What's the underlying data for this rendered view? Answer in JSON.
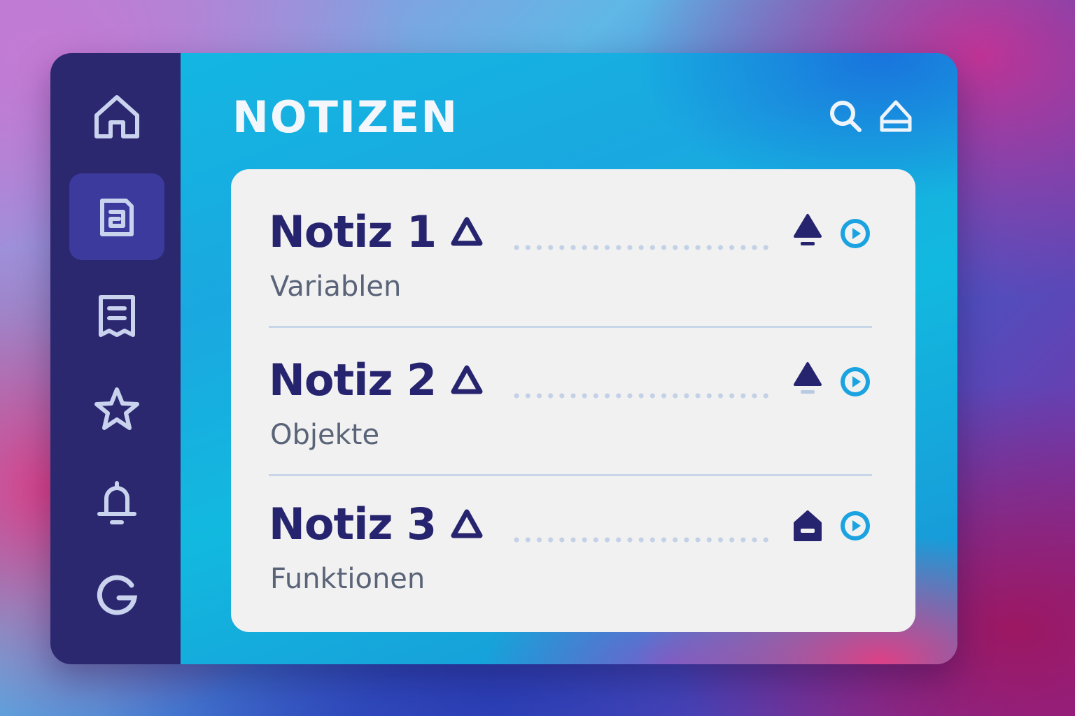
{
  "header": {
    "title": "NOTIZEN"
  },
  "header_icons": [
    "search-icon",
    "eject-icon"
  ],
  "sidebar": {
    "items": [
      {
        "icon": "home-icon",
        "active": false
      },
      {
        "icon": "note-icon",
        "active": true
      },
      {
        "icon": "document-icon",
        "active": false
      },
      {
        "icon": "star-icon",
        "active": false
      },
      {
        "icon": "bell-icon",
        "active": false
      },
      {
        "icon": "g-logo-icon",
        "active": false
      }
    ]
  },
  "notes": [
    {
      "title": "Notiz 1",
      "subtitle": "Variablen",
      "status_icon": "bell-solid-icon"
    },
    {
      "title": "Notiz 2",
      "subtitle": "Objekte",
      "status_icon": "bell-muted-icon"
    },
    {
      "title": "Notiz 3",
      "subtitle": "Funktionen",
      "status_icon": "home-solid-icon"
    }
  ],
  "colors": {
    "sidebar": "#2b2870",
    "sidebar_active": "#3c3a9c",
    "sidebar_icon": "#c9d3ee",
    "card": "#f1f1f1",
    "note_title": "#26246e",
    "note_subtitle": "#5a6478",
    "accent_play": "#1aa3e0",
    "divider": "#c6d5e8"
  }
}
